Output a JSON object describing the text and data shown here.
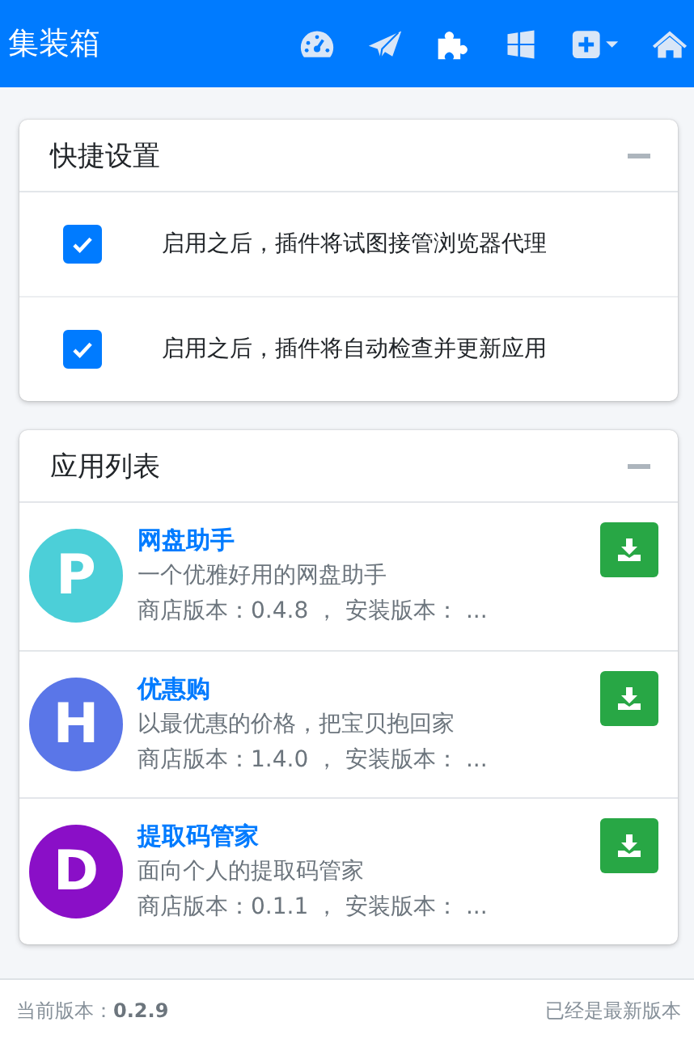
{
  "navbar": {
    "brand": "集装箱",
    "icons": [
      {
        "kind": "gauge"
      },
      {
        "kind": "plane"
      },
      {
        "kind": "puzzle"
      },
      {
        "kind": "windows"
      },
      {
        "kind": "plus-menu"
      },
      {
        "kind": "home"
      }
    ]
  },
  "quick_settings": {
    "title": "快捷设置",
    "collapsed": false,
    "items": [
      {
        "label": "启用之后，插件将试图接管浏览器代理",
        "checked": true
      },
      {
        "label": "启用之后，插件将自动检查并更新应用",
        "checked": true
      }
    ]
  },
  "app_list": {
    "title": "应用列表",
    "collapsed": false,
    "items": [
      {
        "letter": "P",
        "color": "#4ccfd8",
        "name": "网盘助手",
        "description": "一个优雅好用的网盘助手",
        "versions": "商店版本：0.4.8 ， 安装版本： ..."
      },
      {
        "letter": "H",
        "color": "#5a76e8",
        "name": "优惠购",
        "description": "以最优惠的价格，把宝贝抱回家",
        "versions": "商店版本：1.4.0 ， 安装版本： ..."
      },
      {
        "letter": "D",
        "color": "#8a0fc7",
        "name": "提取码管家",
        "description": "面向个人的提取码管家",
        "versions": "商店版本：0.1.1 ， 安装版本： ..."
      }
    ]
  },
  "footer": {
    "current_version": "当前版本：**0.2.9**",
    "status": "已经是最新版本"
  }
}
